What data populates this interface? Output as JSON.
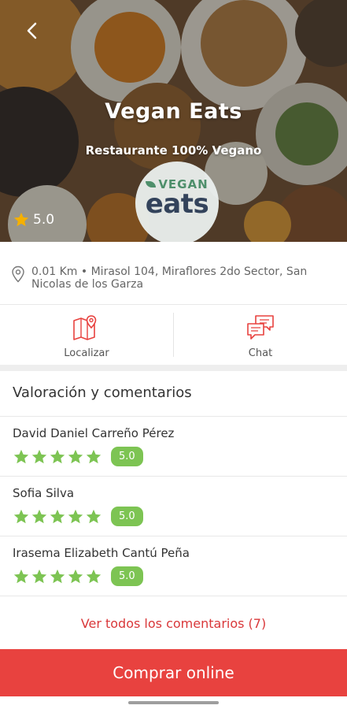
{
  "restaurant": {
    "name": "Vegan Eats",
    "subtitle": "Restaurante 100% Vegano",
    "logo_top": "VEGAN",
    "logo_bottom": "eats",
    "rating": "5.0"
  },
  "address": {
    "text": "0.01 Km  •  Mirasol 104, Miraflores 2do Sector, San Nicolas de los Garza"
  },
  "actions": {
    "locate_label": "Localizar",
    "chat_label": "Chat"
  },
  "reviews": {
    "title": "Valoración y comentarios",
    "items": [
      {
        "name": "David Daniel Carreño Pérez",
        "score": "5.0",
        "stars": 5
      },
      {
        "name": "Sofia Silva",
        "score": "5.0",
        "stars": 5
      },
      {
        "name": "Irasema Elizabeth Cantú Peña",
        "score": "5.0",
        "stars": 5
      }
    ],
    "see_all": "Ver todos los comentarios (7)"
  },
  "buy_label": "Comprar online",
  "colors": {
    "accent": "#e8423f",
    "star_green": "#7dc453",
    "star_gold": "#f5b000"
  }
}
